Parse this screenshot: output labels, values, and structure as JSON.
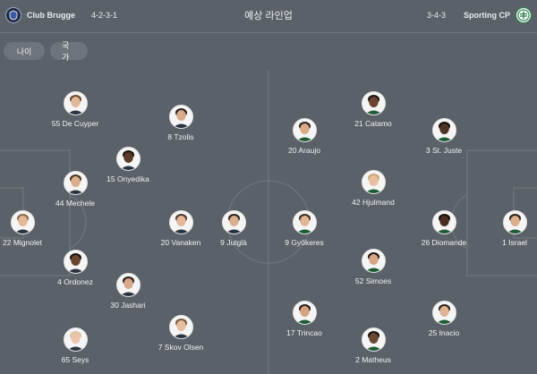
{
  "header": {
    "title": "예상 라인업",
    "home": {
      "name": "Club Brugge",
      "formation": "4-2-3-1",
      "crest_icon": "club-brugge-crest"
    },
    "away": {
      "name": "Sporting CP",
      "formation": "3-4-3",
      "crest_icon": "sporting-cp-crest"
    }
  },
  "tabs": [
    {
      "label": "나이"
    },
    {
      "label": "국가"
    }
  ],
  "colors": {
    "background": "#5b6169",
    "lines": "#6c7279",
    "tab": "#6e747b",
    "avatar": "#f5f5f5"
  },
  "home_players": [
    {
      "label": "55 De Cuyper",
      "skin": "#e0b89b",
      "hair": "#6b4a2f"
    },
    {
      "label": "8 Tzolis",
      "skin": "#d9ad8c",
      "hair": "#2b211b"
    },
    {
      "label": "15 Onyedika",
      "skin": "#5a3a28",
      "hair": "#1b1410"
    },
    {
      "label": "44 Mechele",
      "skin": "#dcae8e",
      "hair": "#4a3526"
    },
    {
      "label": "22 Mignolet",
      "skin": "#e3b899",
      "hair": "#8a6a45"
    },
    {
      "label": "20 Vanaken",
      "skin": "#e4b89a",
      "hair": "#4b3a2c"
    },
    {
      "label": "9 Jutglà",
      "skin": "#dcae90",
      "hair": "#2a201a"
    },
    {
      "label": "4 Ordonez",
      "skin": "#6b4631",
      "hair": "#1a1310"
    },
    {
      "label": "30 Jashari",
      "skin": "#d8a988",
      "hair": "#2a1e16"
    },
    {
      "label": "7 Skov Olsen",
      "skin": "#e6bda0",
      "hair": "#7a5a3a"
    },
    {
      "label": "65 Seys",
      "skin": "#eac5ab",
      "hair": "#d9c7a0"
    }
  ],
  "away_players": [
    {
      "label": "21 Catamo",
      "skin": "#6a4530",
      "hair": "#1b1410"
    },
    {
      "label": "20 Araujo",
      "skin": "#d9ab8a",
      "hair": "#2b211b"
    },
    {
      "label": "3 St. Juste",
      "skin": "#4f3324",
      "hair": "#16100c"
    },
    {
      "label": "42 Hjulmand",
      "skin": "#e7c0a3",
      "hair": "#c8a577"
    },
    {
      "label": "9 Gyökeres",
      "skin": "#e2b595",
      "hair": "#3b2c20"
    },
    {
      "label": "26 Diomande",
      "skin": "#4a2f21",
      "hair": "#14100c"
    },
    {
      "label": "1 Israel",
      "skin": "#dcae8e",
      "hair": "#2a201a"
    },
    {
      "label": "52 Simoes",
      "skin": "#d6a786",
      "hair": "#1e1611"
    },
    {
      "label": "17 Trincao",
      "skin": "#d3a382",
      "hair": "#2a1e16"
    },
    {
      "label": "25 Inacio",
      "skin": "#e0b393",
      "hair": "#2b211b"
    },
    {
      "label": "2 Matheus",
      "skin": "#6b4833",
      "hair": "#1a1310"
    }
  ]
}
